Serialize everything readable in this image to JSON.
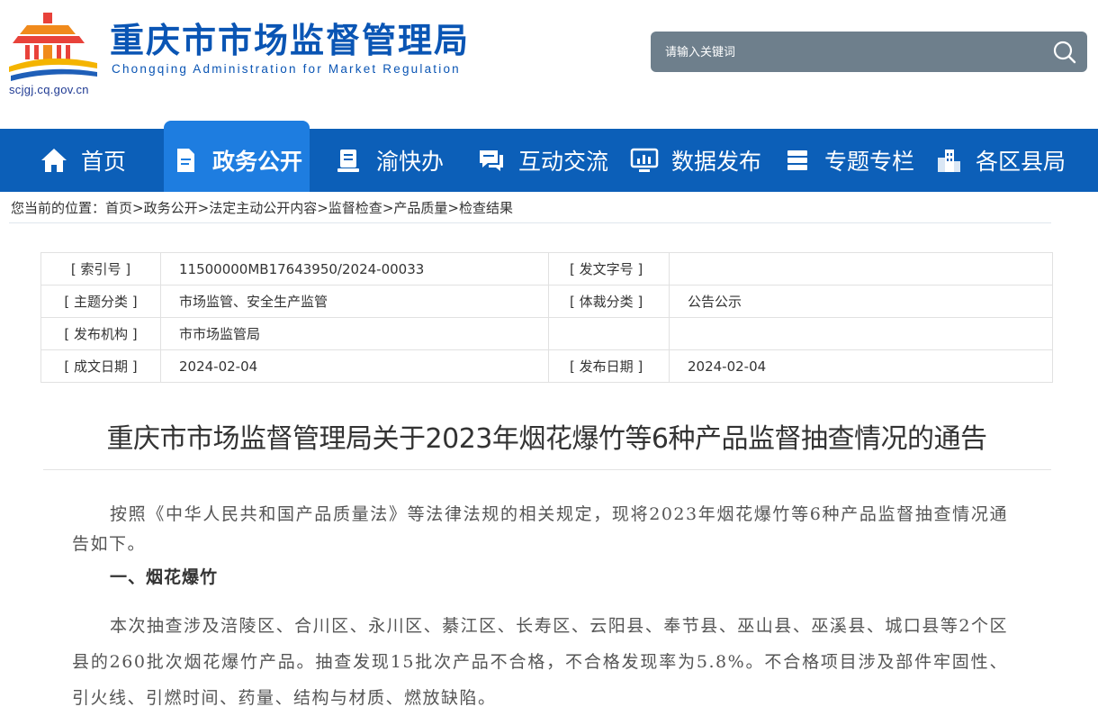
{
  "header": {
    "title": "重庆市市场监督管理局",
    "subtitle": "Chongqing Administration for Market Regulation",
    "domain": "scjgj.cq.gov.cn",
    "search_placeholder": "请输入关键词"
  },
  "nav": {
    "items": [
      {
        "label": "首页",
        "icon": "home-icon"
      },
      {
        "label": "政务公开",
        "icon": "document-icon",
        "active": true
      },
      {
        "label": "渝快办",
        "icon": "service-icon"
      },
      {
        "label": "互动交流",
        "icon": "chat-icon"
      },
      {
        "label": "数据发布",
        "icon": "monitor-chart-icon"
      },
      {
        "label": "专题专栏",
        "icon": "stack-icon"
      },
      {
        "label": "各区县局",
        "icon": "building-icon"
      }
    ]
  },
  "breadcrumb": {
    "prefix": "您当前的位置：",
    "items": [
      "首页",
      "政务公开",
      "法定主动公开内容",
      "监督检查",
      "产品质量",
      "检查结果"
    ],
    "separator": ">"
  },
  "meta": {
    "index_label": "[ 索引号 ]",
    "index_value": "11500000MB17643950/2024-00033",
    "doc_no_label": "[ 发文字号 ]",
    "doc_no_value": "",
    "topic_label": "[ 主题分类 ]",
    "topic_value": "市场监管、安全生产监管",
    "genre_label": "[ 体裁分类 ]",
    "genre_value": "公告公示",
    "org_label": "[ 发布机构 ]",
    "org_value": "市市场监管局",
    "made_label": "[ 成文日期 ]",
    "made_value": "2024-02-04",
    "pub_label": "[ 发布日期 ]",
    "pub_value": "2024-02-04"
  },
  "article": {
    "title": "重庆市市场监督管理局关于2023年烟花爆竹等6种产品监督抽查情况的通告",
    "intro": "按照《中华人民共和国产品质量法》等法律法规的相关规定，现将2023年烟花爆竹等6种产品监督抽查情况通告如下。",
    "section1_head": "一、烟花爆竹",
    "section1_body": "本次抽查涉及涪陵区、合川区、永川区、綦江区、长寿区、云阳县、奉节县、巫山县、巫溪县、城口县等2个区县的260批次烟花爆竹产品。抽查发现15批次产品不合格，不合格发现率为5.8%。不合格项目涉及部件牢固性、引火线、引燃时间、药量、结构与材质、燃放缺陷。"
  },
  "colors": {
    "brand_blue": "#0a55b4",
    "nav_bg": "#0c5fb8",
    "nav_active": "#1e7de0",
    "search_bg": "#6e7f8c"
  }
}
